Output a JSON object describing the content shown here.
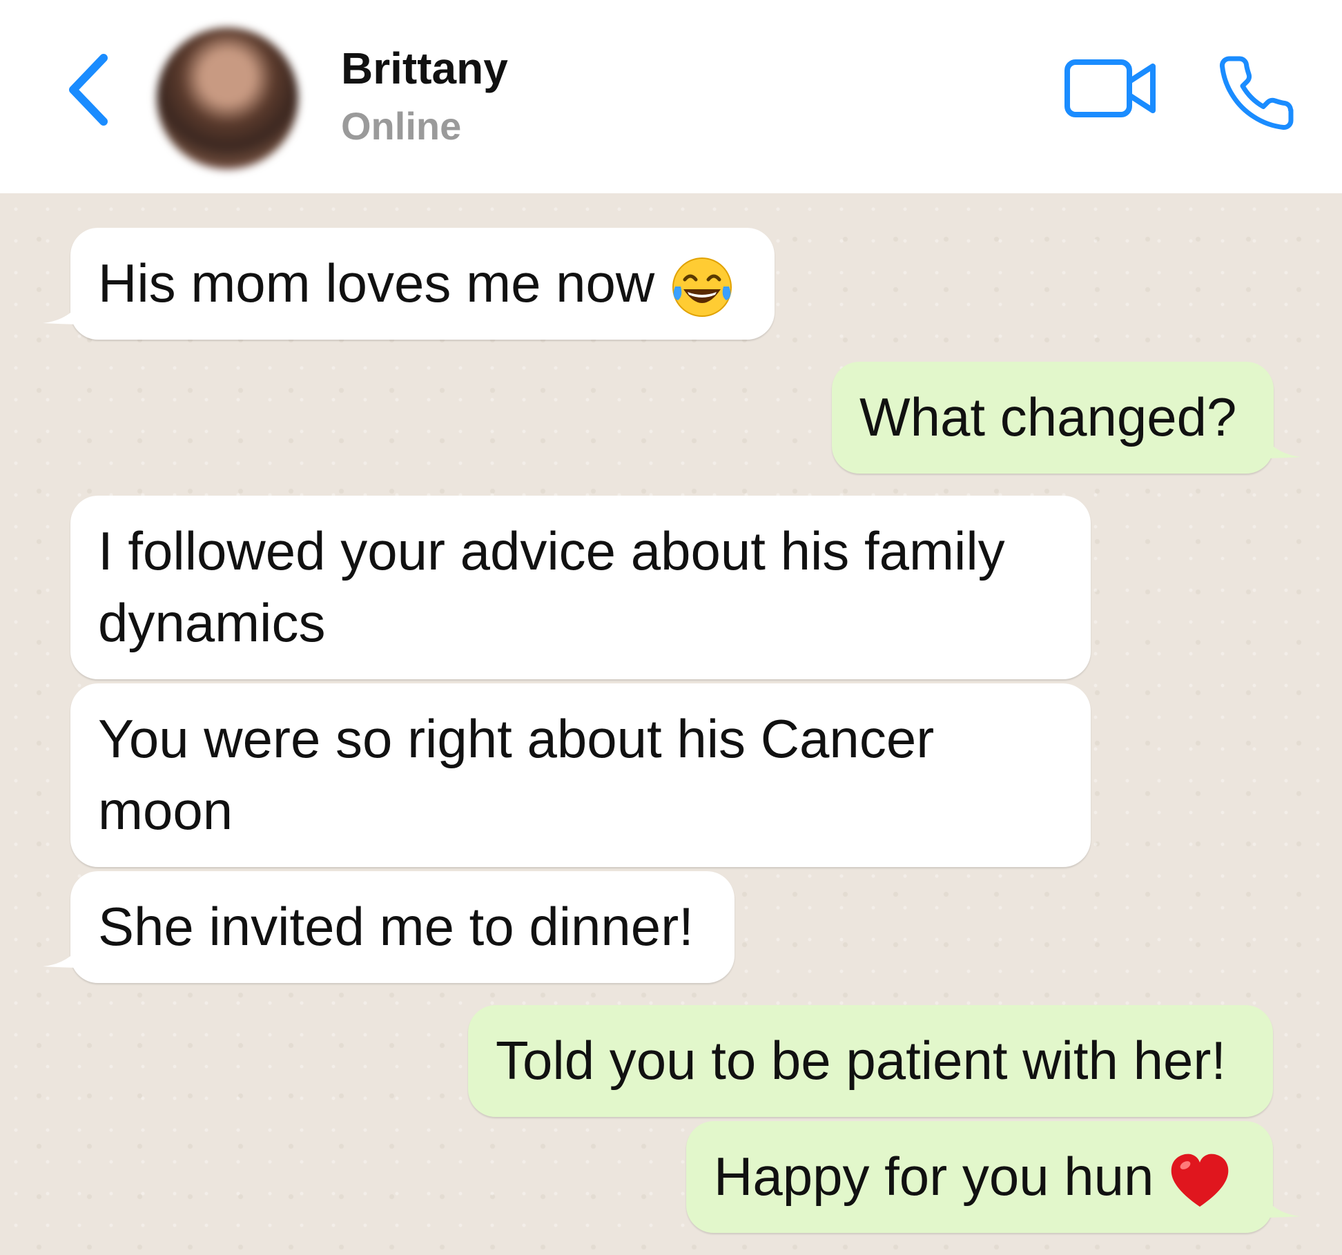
{
  "header": {
    "contact_name": "Brittany",
    "status": "Online"
  },
  "icons": {
    "back": "chevron-left-icon",
    "video": "video-camera-icon",
    "call": "phone-icon",
    "accent": "#1a8cff"
  },
  "messages": [
    {
      "direction": "incoming",
      "text": "His mom loves me now",
      "emoji": "face-with-tears-of-joy"
    },
    {
      "direction": "outgoing",
      "text": "What changed?"
    },
    {
      "direction": "incoming",
      "text": "I followed your advice about his family dynamics"
    },
    {
      "direction": "incoming",
      "text": "You were so right about his Cancer moon"
    },
    {
      "direction": "incoming",
      "text": "She invited me to dinner!"
    },
    {
      "direction": "outgoing",
      "text": "Told you to be patient with her!"
    },
    {
      "direction": "outgoing",
      "text": "Happy for you hun",
      "emoji": "red-heart"
    }
  ],
  "colors": {
    "incoming_bubble": "#ffffff",
    "outgoing_bubble": "#e2f7cb",
    "chat_background": "#ece5dd"
  }
}
